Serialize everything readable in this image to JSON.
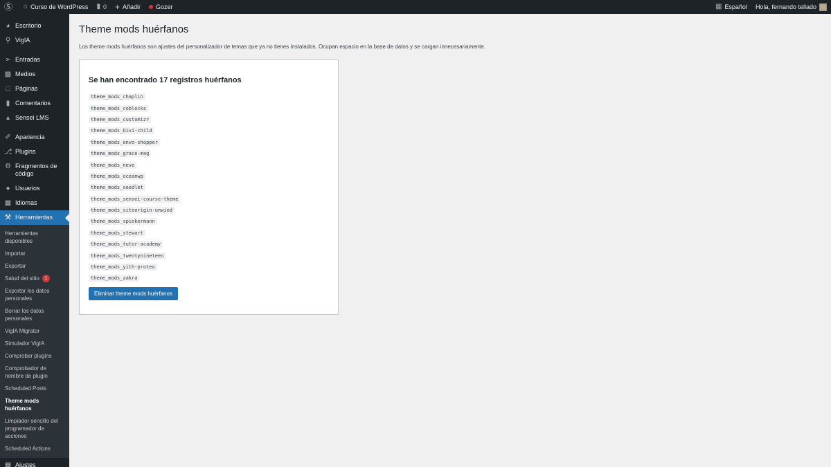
{
  "adminbar": {
    "site_name": "Curso de WordPress",
    "comments_count": "0",
    "add_new": "Añadir",
    "plugin_item": "Gozer",
    "language": "Español",
    "greeting": "Hola, fernando tellado"
  },
  "sidebar": {
    "items": [
      {
        "label": "Escritorio",
        "icon": "gauge-icon"
      },
      {
        "label": "VigIA",
        "icon": "search-icon"
      },
      {
        "label": "Entradas",
        "icon": "pin-icon"
      },
      {
        "label": "Medios",
        "icon": "media-icon"
      },
      {
        "label": "Páginas",
        "icon": "page-icon"
      },
      {
        "label": "Comentarios",
        "icon": "comment-icon"
      },
      {
        "label": "Sensei LMS",
        "icon": "sensei-icon"
      },
      {
        "label": "Apariencia",
        "icon": "brush-icon"
      },
      {
        "label": "Plugins",
        "icon": "plugin-icon"
      },
      {
        "label": "Fragmentos de código",
        "icon": "code-icon"
      },
      {
        "label": "Usuarios",
        "icon": "user-icon"
      },
      {
        "label": "Idiomas",
        "icon": "translate-icon"
      },
      {
        "label": "Herramientas",
        "icon": "wrench-icon"
      },
      {
        "label": "Ajustes",
        "icon": "settings-icon"
      }
    ],
    "submenu": [
      "Herramientas disponibles",
      "Importar",
      "Exportar",
      "Salud del sitio",
      "Exportar los datos personales",
      "Borrar los datos personales",
      "VigIA Migrator",
      "Simulador VigIA",
      "Comprobar plugins",
      "Comprobador de nombre de plugin",
      "Scheduled Posts",
      "Theme mods huérfanos",
      "Limpiador sencillo del programador de acciones",
      "Scheduled Actions"
    ],
    "site_health_badge": "1"
  },
  "main": {
    "title": "Theme mods huérfanos",
    "description": "Los theme mods huérfanos son ajustes del personalizador de temas que ya no tienes instalados. Ocupan espacio en la base de datos y se cargan innecesariamente.",
    "card_title": "Se han encontrado 17 registros huérfanos",
    "mods": [
      "theme_mods_chaplin",
      "theme_mods_coblocks",
      "theme_mods_customizr",
      "theme_mods_Divi-child",
      "theme_mods_envo-shopper",
      "theme_mods_grace-mag",
      "theme_mods_neve",
      "theme_mods_oceanwp",
      "theme_mods_seedlet",
      "theme_mods_sensei-course-theme",
      "theme_mods_siteorigin-unwind",
      "theme_mods_spiekermann",
      "theme_mods_stewart",
      "theme_mods_tutor-academy",
      "theme_mods_twentynineteen",
      "theme_mods_yith-proteo",
      "theme_mods_zakra"
    ],
    "delete_button": "Eliminar theme mods huérfanos"
  },
  "colors": {
    "adminbar_bg": "#1d2327",
    "accent": "#2271b1",
    "badge": "#d63638",
    "page_bg": "#f0f0f1"
  }
}
